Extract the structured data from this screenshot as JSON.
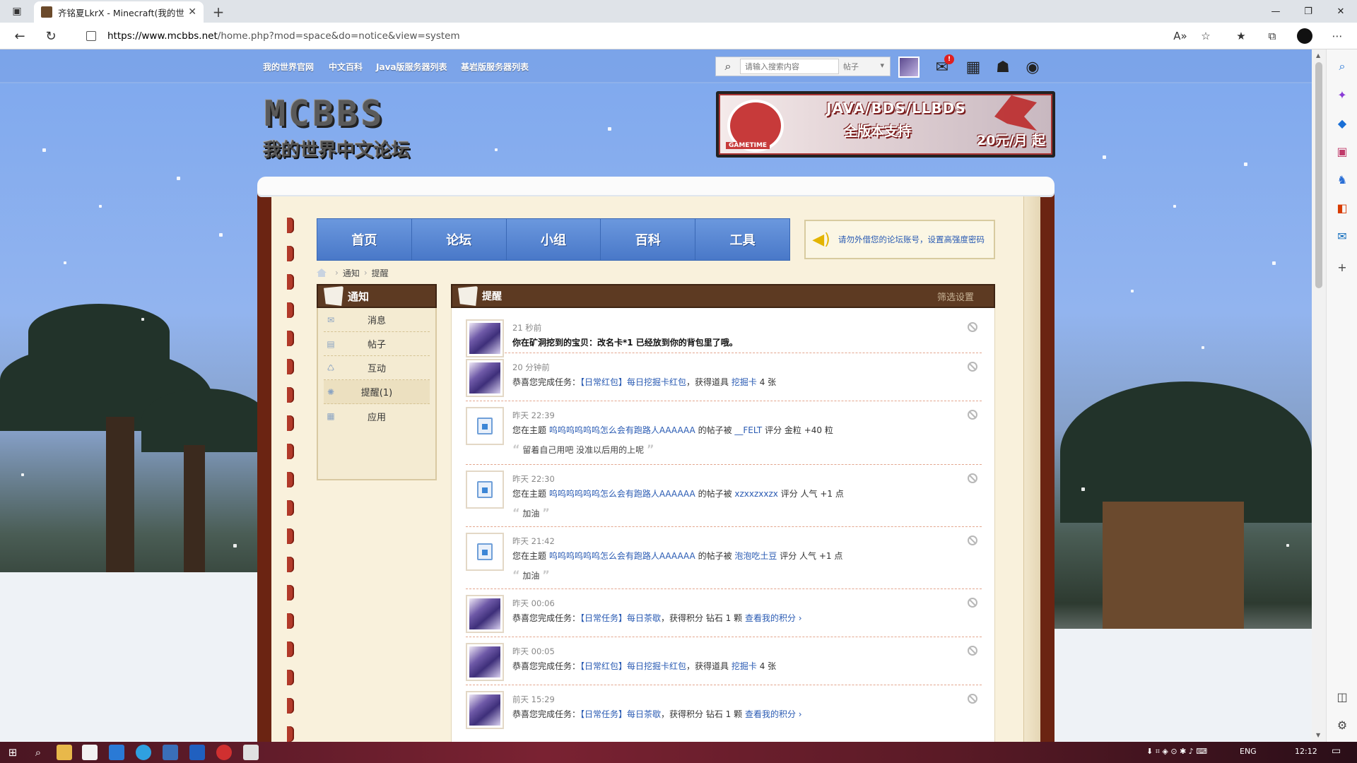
{
  "browser": {
    "tab_title": "齐铭夏LkrX - Minecraft(我的世界",
    "url_host": "https://www.mcbbs.net",
    "url_path": "/home.php?mod=space&do=notice&view=system"
  },
  "topbar": {
    "links": [
      "我的世界官网",
      "中文百科",
      "Java版服务器列表",
      "基岩版服务器列表"
    ],
    "search_placeholder": "请输入搜索内容",
    "search_type": "帖子",
    "badge_count": "!"
  },
  "logo": {
    "big": "MCBBS",
    "small": "我的世界中文论坛"
  },
  "banner": {
    "line1": "JAVA/BDS/LLBDS",
    "line2": "全版本支持",
    "line3": "20元/月 起",
    "brand": "GAMETIME"
  },
  "mainnav": [
    "首页",
    "论坛",
    "小组",
    "百科",
    "工具"
  ],
  "notice_box": "请勿外借您的论坛账号，设置高强度密码",
  "breadcrumb": [
    "通知",
    "提醒"
  ],
  "sidebar": {
    "title": "通知",
    "items": [
      {
        "label": "消息",
        "icon": "envelope-icon"
      },
      {
        "label": "帖子",
        "icon": "document-icon"
      },
      {
        "label": "互动",
        "icon": "interact-icon"
      },
      {
        "label": "提醒(1)",
        "icon": "reminder-icon"
      },
      {
        "label": "应用",
        "icon": "grid-icon"
      }
    ]
  },
  "content": {
    "title": "提醒",
    "filter_label": "筛选设置",
    "notices": [
      {
        "time": "21 秒前",
        "text": "你在矿洞挖到的宝贝：改名卡*1 已经放到你的背包里了哦。"
      },
      {
        "time": "20 分钟前",
        "prefix": "恭喜您完成任务：",
        "link1": "【日常红包】每日挖掘卡红包",
        "mid": "，获得道具 ",
        "link2": "挖掘卡",
        "suffix": " 4 张"
      },
      {
        "time": "昨天 22:39",
        "prefix": "您在主题 ",
        "link1": "呜呜呜呜呜呜怎么会有跑路人AAAAAA",
        "mid": " 的帖子被 ",
        "link2": "__FELT",
        "suffix": " 评分 金粒 +40 粒",
        "quote": "留着自己用吧 没准以后用的上呢"
      },
      {
        "time": "昨天 22:30",
        "prefix": "您在主题 ",
        "link1": "呜呜呜呜呜呜怎么会有跑路人AAAAAA",
        "mid": " 的帖子被 ",
        "link2": "xzxxzxxzx",
        "suffix": " 评分 人气 +1 点",
        "quote": "加油"
      },
      {
        "time": "昨天 21:42",
        "prefix": "您在主题 ",
        "link1": "呜呜呜呜呜呜怎么会有跑路人AAAAAA",
        "mid": " 的帖子被 ",
        "link2": "泡泡吃土豆",
        "suffix": " 评分 人气 +1 点",
        "quote": "加油"
      },
      {
        "time": "昨天 00:06",
        "prefix": "恭喜您完成任务：",
        "link1": "【日常任务】每日茶歇",
        "mid": "，获得积分 钻石 1 颗 ",
        "link2": "查看我的积分 ›",
        "suffix": ""
      },
      {
        "time": "昨天 00:05",
        "prefix": "恭喜您完成任务：",
        "link1": "【日常红包】每日挖掘卡红包",
        "mid": "，获得道具 ",
        "link2": "挖掘卡",
        "suffix": " 4 张"
      },
      {
        "time": "前天 15:29",
        "prefix": "恭喜您完成任务：",
        "link1": "【日常任务】每日茶歇",
        "mid": "，获得积分 钻石 1 颗 ",
        "link2": "查看我的积分 ›",
        "suffix": ""
      }
    ]
  },
  "taskbar": {
    "lang": "ENG",
    "clock": "12:12"
  }
}
